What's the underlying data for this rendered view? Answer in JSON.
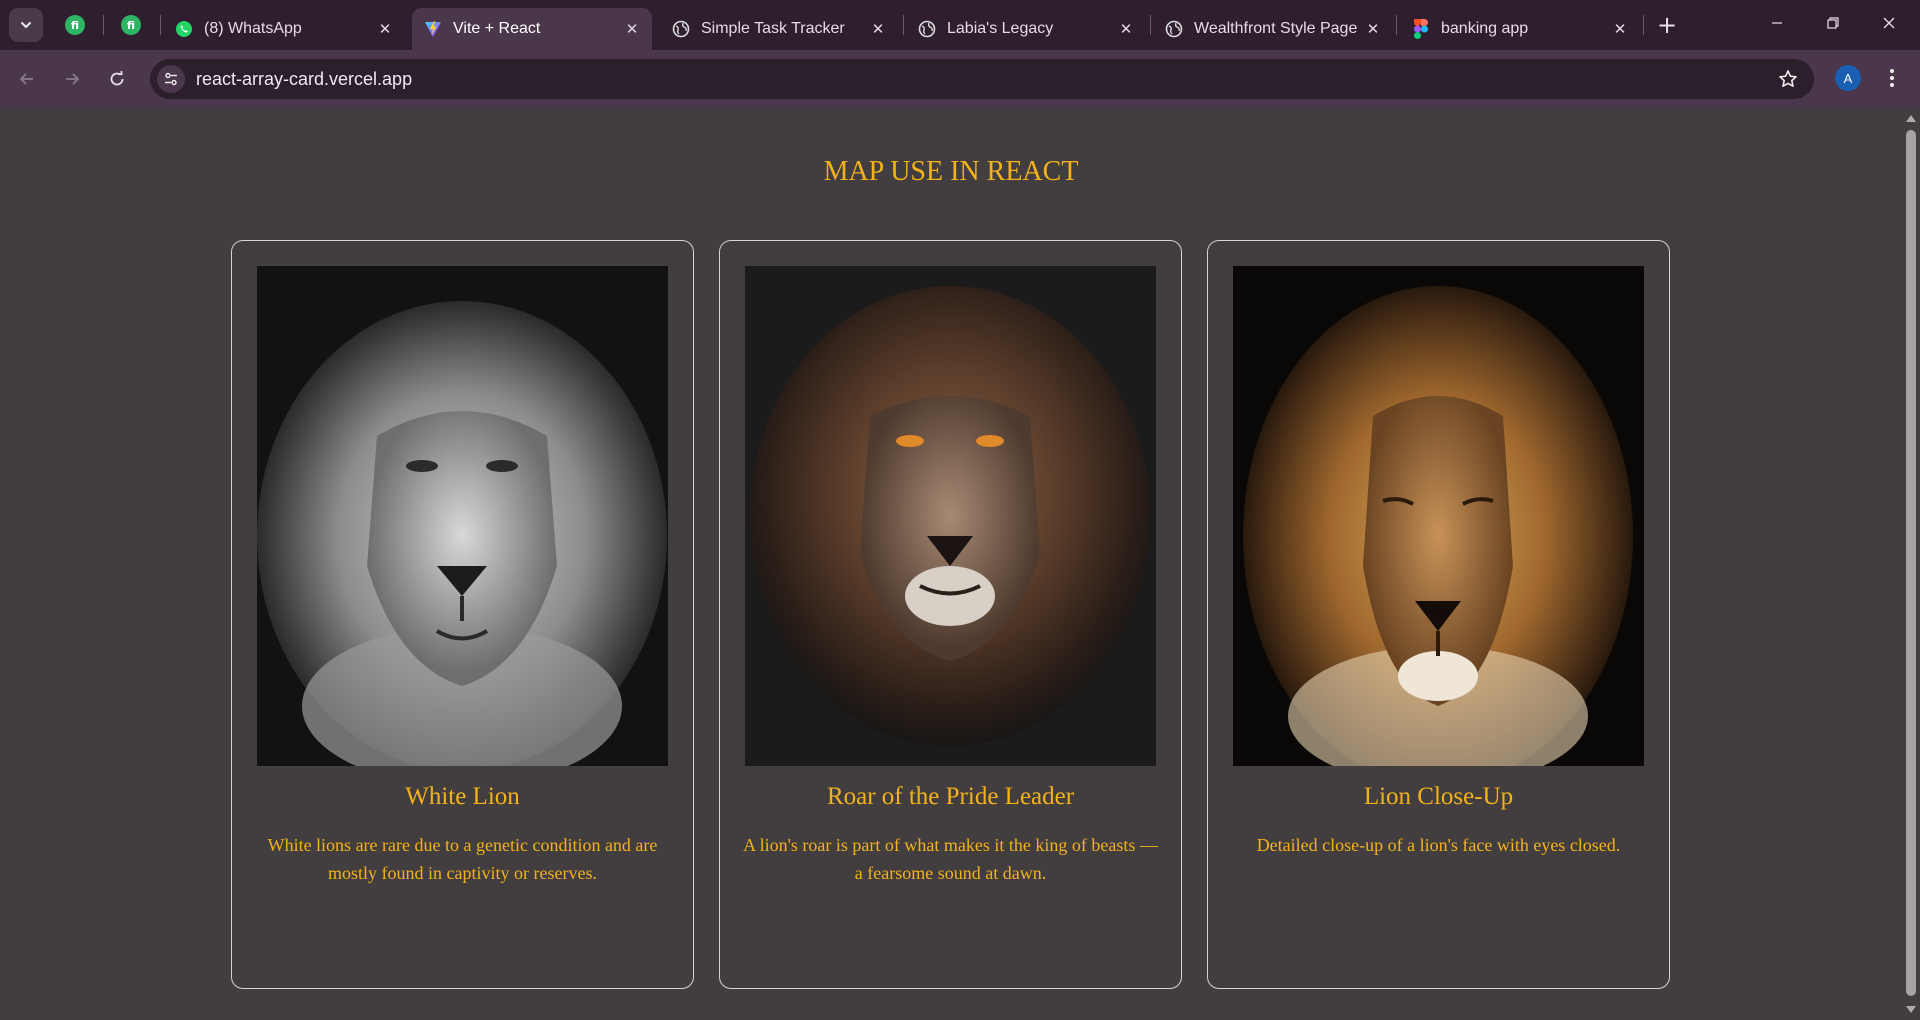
{
  "browser": {
    "tabs": [
      {
        "title": "(8) WhatsApp",
        "icon": "whatsapp-icon",
        "active": false
      },
      {
        "title": "Vite + React",
        "icon": "vite-icon",
        "active": true
      },
      {
        "title": "Simple Task Tracker",
        "icon": "globe-icon",
        "active": false
      },
      {
        "title": "Labia's Legacy",
        "icon": "globe-icon",
        "active": false
      },
      {
        "title": "Wealthfront Style Page",
        "icon": "globe-icon",
        "active": false
      },
      {
        "title": "banking app",
        "icon": "figma-icon",
        "active": false
      }
    ],
    "pinned_tabs": [
      {
        "icon": "fi-icon",
        "label": "fi"
      },
      {
        "icon": "fi-icon",
        "label": "fi"
      }
    ],
    "url": "react-array-card.vercel.app",
    "profile_initial": "A"
  },
  "page": {
    "heading": "MAP USE IN REACT",
    "cards": [
      {
        "title": "White Lion",
        "description": "White lions are rare due to a genetic condition and are mostly found in captivity or reserves.",
        "image": "black-and-white lion portrait"
      },
      {
        "title": "Roar of the Pride Leader",
        "description": "A lion's roar is part of what makes it the king of beasts — a fearsome sound at dawn.",
        "image": "dark brown-maned lion portrait"
      },
      {
        "title": "Lion Close-Up",
        "description": "Detailed close-up of a lion's face with eyes closed.",
        "image": "golden-maned lion close-up"
      }
    ]
  },
  "colors": {
    "accent_text": "#f3b21c",
    "page_background": "#423d3e",
    "browser_frame": "#2e1e2e",
    "active_tab": "#4b374b"
  }
}
